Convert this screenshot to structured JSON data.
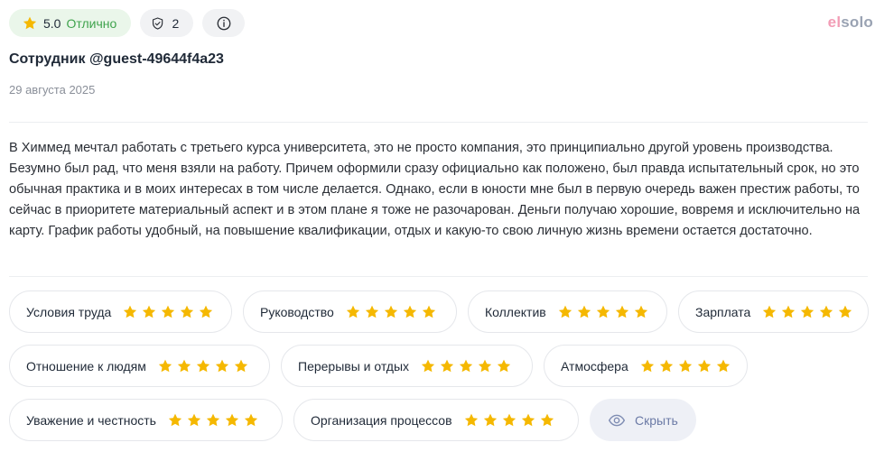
{
  "header": {
    "rating_score": "5.0",
    "rating_grade": "Отлично",
    "shield_count": "2",
    "logo_part1": "el",
    "logo_part2": "solo"
  },
  "review": {
    "author": "Сотрудник @guest-49644f4a23",
    "date": "29 августа 2025",
    "text": "В Химмед мечтал работать с третьего курса университета, это не просто компания, это принципиально другой уровень производства. Безумно был рад, что меня взяли на работу. Причем оформили сразу официально как положено, был правда испытательный срок, но это обычная практика и в моих интересах в том числе делается. Однако, если в юности мне был в первую очередь важен престиж работы, то сейчас в приоритете материальный аспект и в этом плане я тоже не разочарован. Деньги получаю хорошие, вовремя и исключительно на карту. График работы удобный, на повышение квалификации, отдых и какую-то свою личную жизнь времени остается достаточно."
  },
  "criteria": [
    {
      "label": "Условия труда",
      "stars": 5
    },
    {
      "label": "Руководство",
      "stars": 5
    },
    {
      "label": "Коллектив",
      "stars": 5
    },
    {
      "label": "Зарплата",
      "stars": 5
    },
    {
      "label": "Отношение к людям",
      "stars": 5
    },
    {
      "label": "Перерывы и отдых",
      "stars": 5
    },
    {
      "label": "Атмосфера",
      "stars": 5
    },
    {
      "label": "Уважение и честность",
      "stars": 5
    },
    {
      "label": "Организация процессов",
      "stars": 5
    }
  ],
  "hide_button_label": "Скрыть",
  "colors": {
    "star": "#f5b800",
    "rating_pill_bg": "#eaf6ea",
    "grade_text": "#3fa34d",
    "hide_button_text": "#6b7aa6"
  },
  "icons": {
    "rating": "star-icon",
    "shield": "shield-check-icon",
    "info": "info-icon",
    "hide": "eye-icon"
  }
}
